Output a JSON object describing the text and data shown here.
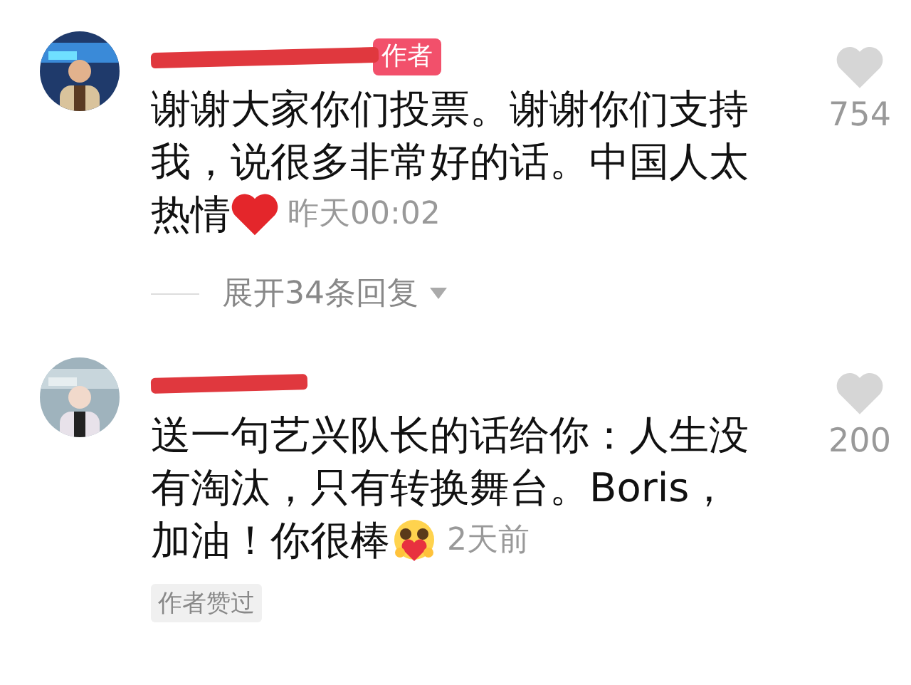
{
  "comments": [
    {
      "author_badge": "作者",
      "text_lines": [
        "谢谢大家你们投票。谢谢你们支持",
        "我，说很多非常好的话。中国人太",
        "热情"
      ],
      "emoji": {
        "kind": "heart"
      },
      "time": "昨天00:02",
      "liked": false,
      "likes": "754",
      "replies": "展开34条回复"
    },
    {
      "text_lines": [
        "送一句艺兴队长的话给你：人生没",
        "有淘汰，只有转换舞台。Boris，",
        "加油！你很棒"
      ],
      "emoji": {
        "kind": "hug_heart"
      },
      "time": "2天前",
      "liked": false,
      "likes": "200",
      "liked_by_author": "作者赞过"
    }
  ]
}
